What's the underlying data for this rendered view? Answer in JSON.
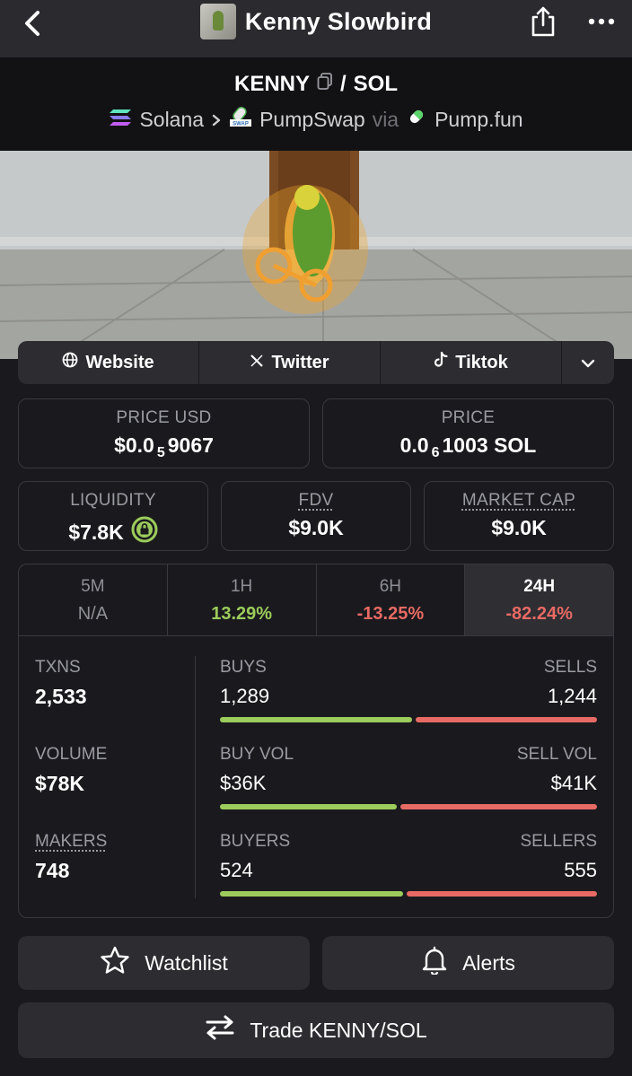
{
  "header": {
    "title": "Kenny Slowbird"
  },
  "pair": {
    "base": "KENNY",
    "separator": "/",
    "quote": "SOL"
  },
  "chain": {
    "network": "Solana",
    "dex": "PumpSwap",
    "via": "via",
    "launchpad": "Pump.fun"
  },
  "links": [
    {
      "label": "Website",
      "icon": "globe-icon"
    },
    {
      "label": "Twitter",
      "icon": "x-logo-icon"
    },
    {
      "label": "Tiktok",
      "icon": "tiktok-icon"
    }
  ],
  "price_usd": {
    "label": "PRICE USD",
    "prefix": "$0.0",
    "sub": "5",
    "suffix": "9067"
  },
  "price_native": {
    "label": "PRICE",
    "prefix": "0.0",
    "sub": "6",
    "suffix": "1003 SOL"
  },
  "liquidity": {
    "label": "LIQUIDITY",
    "value": "$7.8K"
  },
  "fdv": {
    "label": "FDV",
    "value": "$9.0K"
  },
  "market_cap": {
    "label": "MARKET CAP",
    "value": "$9.0K"
  },
  "timeframes": [
    {
      "label": "5M",
      "value": "N/A"
    },
    {
      "label": "1H",
      "value": "13.29%"
    },
    {
      "label": "6H",
      "value": "-13.25%"
    },
    {
      "label": "24H",
      "value": "-82.24%"
    }
  ],
  "txns": {
    "label": "TXNS",
    "value": "2,533"
  },
  "volume": {
    "label": "VOLUME",
    "value": "$78K"
  },
  "makers": {
    "label": "MAKERS",
    "value": "748"
  },
  "buys_sells": {
    "left_label": "BUYS",
    "right_label": "SELLS",
    "left": "1,289",
    "right": "1,244",
    "buy_fraction": 0.509
  },
  "vol_split": {
    "left_label": "BUY VOL",
    "right_label": "SELL VOL",
    "left": "$36K",
    "right": "$41K",
    "buy_fraction": 0.468
  },
  "buyers_sellers": {
    "left_label": "BUYERS",
    "right_label": "SELLERS",
    "left": "524",
    "right": "555",
    "buy_fraction": 0.486
  },
  "actions": {
    "watchlist": "Watchlist",
    "alerts": "Alerts",
    "trade": "Trade KENNY/SOL"
  },
  "colors": {
    "positive": "#9ccc5b",
    "negative": "#e86a64",
    "background": "#1a1a1e",
    "surface": "#2c2c31"
  }
}
